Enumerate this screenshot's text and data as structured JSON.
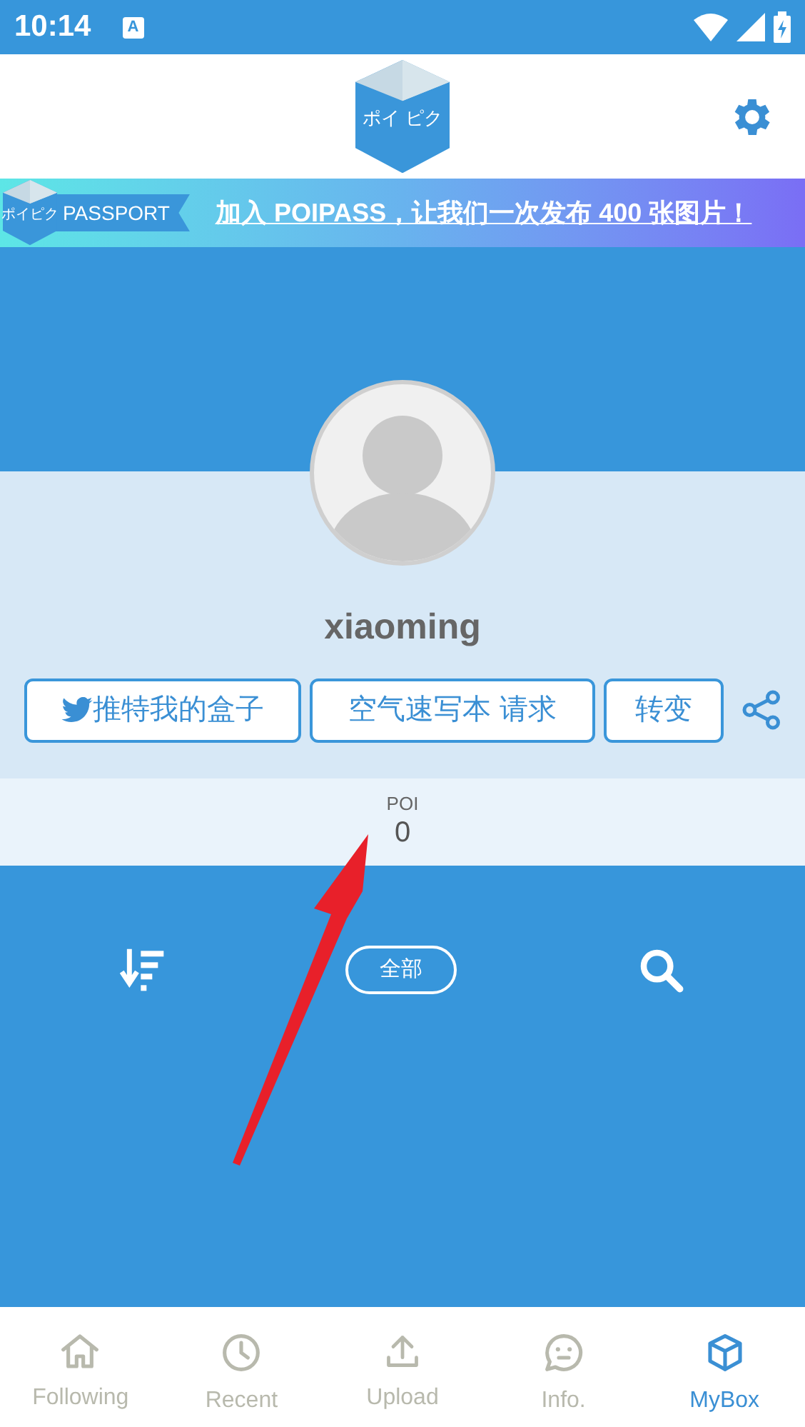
{
  "status_bar": {
    "time": "10:14",
    "notification_icon": "A"
  },
  "header": {
    "logo_text": "ポイ ピク"
  },
  "banner": {
    "badge_logo_text": "ポイピク",
    "badge_label": "PASSPORT",
    "link": "加入 POIPASS，让我们一次发布 400 张图片！"
  },
  "profile": {
    "username": "xiaoming"
  },
  "actions": [
    {
      "kind": "twitter",
      "label": "推特我的盒子"
    },
    {
      "kind": "plain",
      "label": "空气速写本 请求"
    },
    {
      "kind": "plain",
      "label": "转变"
    }
  ],
  "stats": {
    "label": "POI",
    "value": "0"
  },
  "toolbar": {
    "filter": "全部"
  },
  "nav": [
    {
      "label": "Following",
      "kind": "home",
      "selected": false
    },
    {
      "label": "Recent",
      "kind": "clock",
      "selected": false
    },
    {
      "label": "Upload",
      "kind": "upload",
      "selected": false
    },
    {
      "label": "Info.",
      "kind": "chat",
      "selected": false
    },
    {
      "label": "MyBox",
      "kind": "box",
      "selected": true
    }
  ]
}
